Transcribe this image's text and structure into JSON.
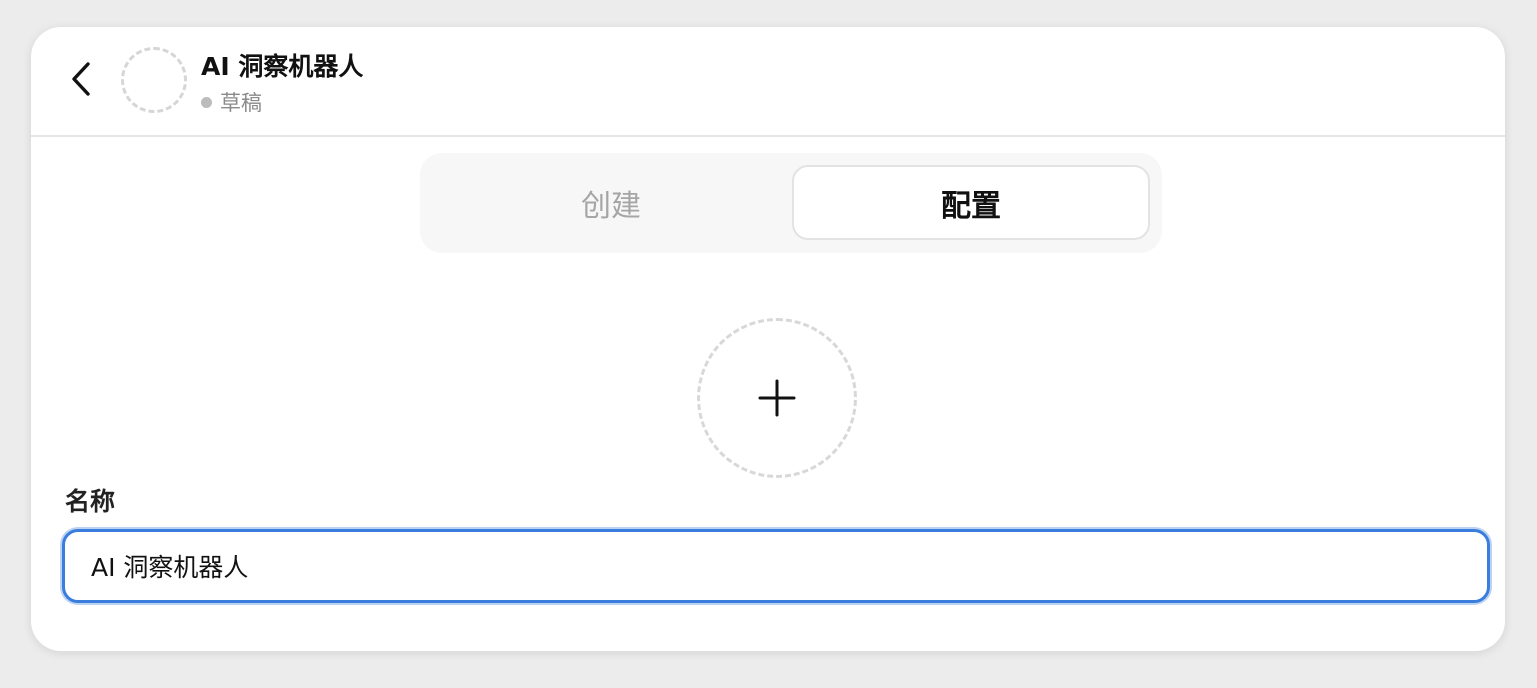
{
  "header": {
    "back_icon": "chevron-left-icon",
    "avatar_icon": "dashed-circle-placeholder",
    "title": "AI 洞察机器人",
    "status": "草稿",
    "status_dot_color": "#bcbcbc"
  },
  "tabs": [
    {
      "label": "创建",
      "active": false
    },
    {
      "label": "配置",
      "active": true
    }
  ],
  "upload": {
    "icon": "plus-icon"
  },
  "form": {
    "name_label": "名称",
    "name_value": "AI 洞察机器人",
    "focus_color": "#3b7ddd"
  }
}
